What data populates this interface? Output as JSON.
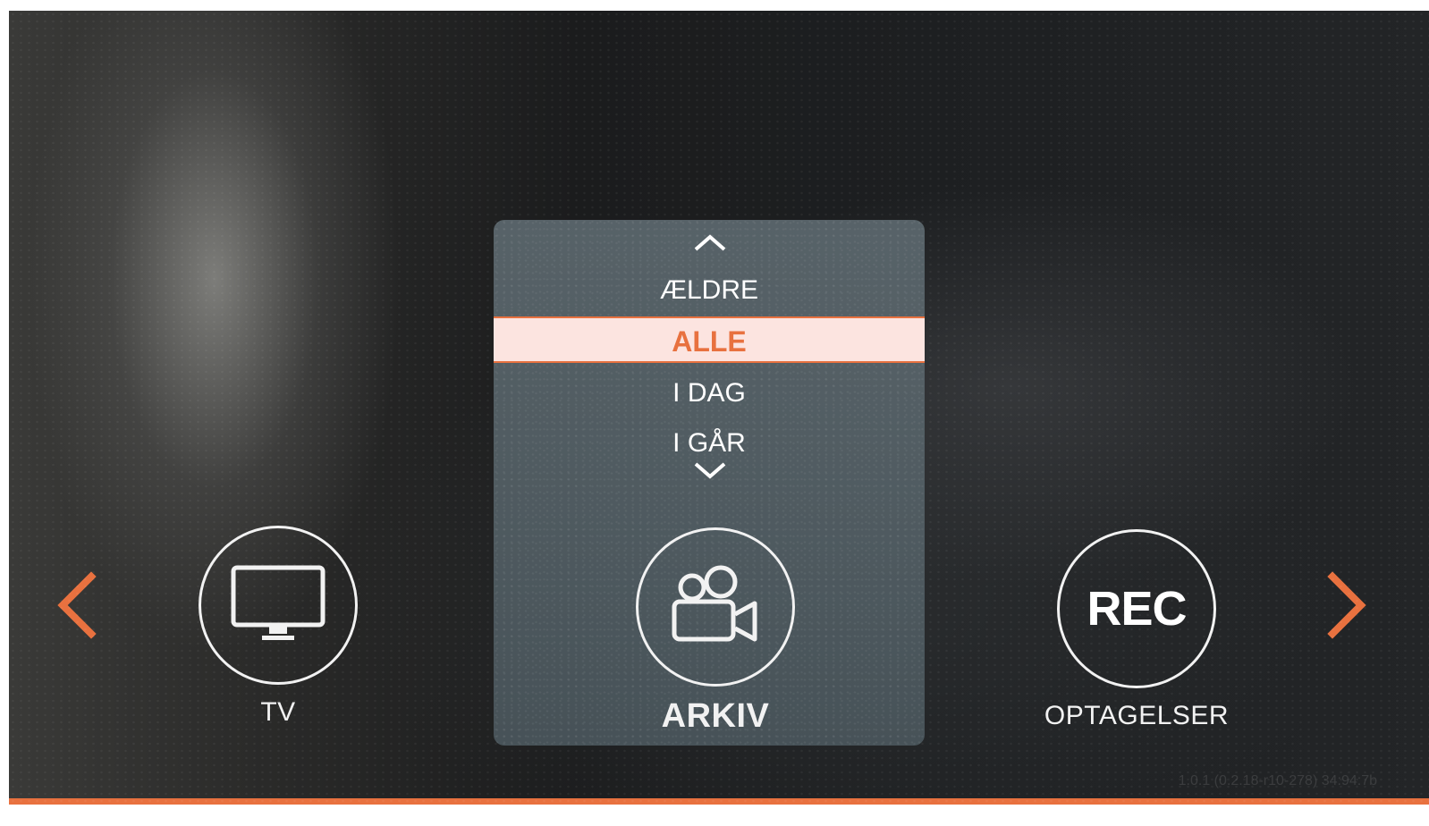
{
  "nav": {
    "prev_icon": "chevron-left-icon",
    "next_icon": "chevron-right-icon"
  },
  "tiles": {
    "tv": {
      "label": "TV",
      "icon": "tv-monitor-icon"
    },
    "arkiv": {
      "label": "ARKIV",
      "icon": "video-camera-icon"
    },
    "rec": {
      "label": "OPTAGELSER",
      "icon_text": "REC"
    }
  },
  "dropdown": {
    "scroll_up_icon": "chevron-up-icon",
    "scroll_down_icon": "chevron-down-icon",
    "options": [
      "ÆLDRE",
      "ALLE",
      "I DAG",
      "I GÅR"
    ],
    "selected": "ALLE"
  },
  "version_text": "1.0.1 (0.2.18-r10-278) 34:94:7b",
  "colors": {
    "accent": "#e8713f",
    "selected_bg": "#fce4e0",
    "text": "#f2f2f2"
  }
}
